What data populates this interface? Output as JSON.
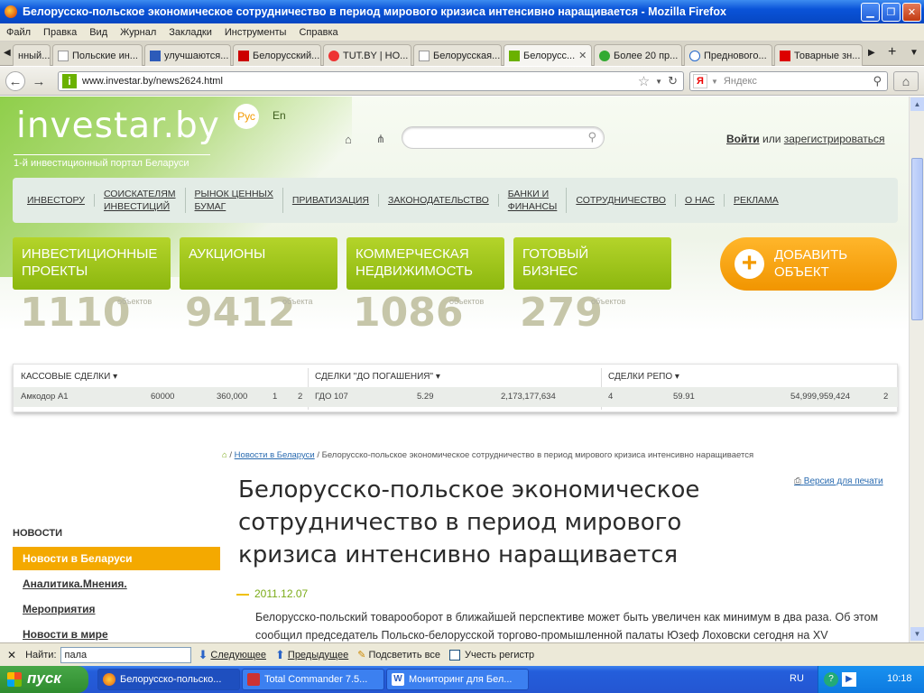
{
  "window": {
    "title": "Белорусско-польское экономическое сотрудничество в период мирового кризиса интенсивно наращивается - Mozilla Firefox"
  },
  "menu": [
    "Файл",
    "Правка",
    "Вид",
    "Журнал",
    "Закладки",
    "Инструменты",
    "Справка"
  ],
  "tabs": [
    {
      "label": "нный..."
    },
    {
      "label": "Польские ин..."
    },
    {
      "label": "улучшаются..."
    },
    {
      "label": "Белорусский..."
    },
    {
      "label": "TUT.BY | НО..."
    },
    {
      "label": "Белорусская..."
    },
    {
      "label": "Белорусс..."
    },
    {
      "label": "Более 20 пр..."
    },
    {
      "label": "Предновогo..."
    },
    {
      "label": "Товарные зн..."
    }
  ],
  "address": {
    "url": "www.investar.by/news2624.html",
    "search_placeholder": "Яндекс"
  },
  "site": {
    "logo": "investar.by",
    "tagline": "1-й инвестиционный портал Беларуси",
    "lang_ru": "Рус",
    "lang_en": "En",
    "login": "Войти",
    "or": "или",
    "register": "зарегистрироваться"
  },
  "nav": [
    "ИНВЕСТОРУ",
    "СОИСКАТЕЛЯМ\nИНВЕСТИЦИЙ",
    "РЫНОК ЦЕННЫХ\nБУМАГ",
    "ПРИВАТИЗАЦИЯ",
    "ЗАКОНОДАТЕЛЬСТВО",
    "БАНКИ И\nФИНАНСЫ",
    "СОТРУДНИЧЕСТВО",
    "О НАС",
    "РЕКЛАМА"
  ],
  "categories": [
    {
      "label": "ИНВЕСТИЦИОННЫЕ\nПРОЕКТЫ",
      "count": "1110",
      "unit": "объектов"
    },
    {
      "label": "АУКЦИОНЫ",
      "count": "9412",
      "unit": "объекта"
    },
    {
      "label": "КОММЕРЧЕСКАЯ\nНЕДВИЖИМОСТЬ",
      "count": "1086",
      "unit": "объектов"
    },
    {
      "label": "ГОТОВЫЙ\nБИЗНЕС",
      "count": "279",
      "unit": "объектов"
    }
  ],
  "add_button": "ДОБАВИТЬ\nОБЪЕКТ",
  "ticker": [
    {
      "header": "КАССОВЫЕ СДЕЛКИ",
      "cells": [
        "Амкодор А1",
        "60000",
        "360,000",
        "1",
        "2"
      ]
    },
    {
      "header": "СДЕЛКИ \"ДО ПОГАШЕНИЯ\"",
      "cells": [
        "ГДО 107",
        "5.29",
        "2,173,177,634"
      ]
    },
    {
      "header": "СДЕЛКИ РЕПО",
      "cells": [
        "4",
        "59.91",
        "54,999,959,424",
        "2"
      ]
    }
  ],
  "breadcrumb": {
    "section": "Новости в Беларуси",
    "current": "Белорусско-польское экономическое сотрудничество в период мирового кризиса интенсивно наращивается"
  },
  "print_label": "Версия для печати",
  "article": {
    "title": "Белорусско-польское экономическое сотрудничество в период мирового кризиса интенсивно наращивается",
    "date": "2011.12.07",
    "body": "Белорусско-польский товарооборот в ближайшей перспективе может быть увеличен как минимум в два раза. Об этом сообщил председатель Польско-белорусской торгово-промышленной палаты Юзеф Лоховски сегодня на XV"
  },
  "sidebar": {
    "heading": "НОВОСТИ",
    "items": [
      "Новости в Беларуси",
      "Аналитика.Мнения.",
      "Мероприятия",
      "Новости в мире"
    ]
  },
  "findbar": {
    "label": "Найти:",
    "query": "пала",
    "next": "Следующее",
    "prev": "Предыдущее",
    "highlight": "Подсветить все",
    "match_case": "Учесть регистр"
  },
  "taskbar": {
    "start": "пуск",
    "tasks": [
      "Белорусско-польско...",
      "Total Commander 7.5...",
      "Мониторинг для Бел..."
    ],
    "lang": "RU",
    "time": "10:18"
  }
}
